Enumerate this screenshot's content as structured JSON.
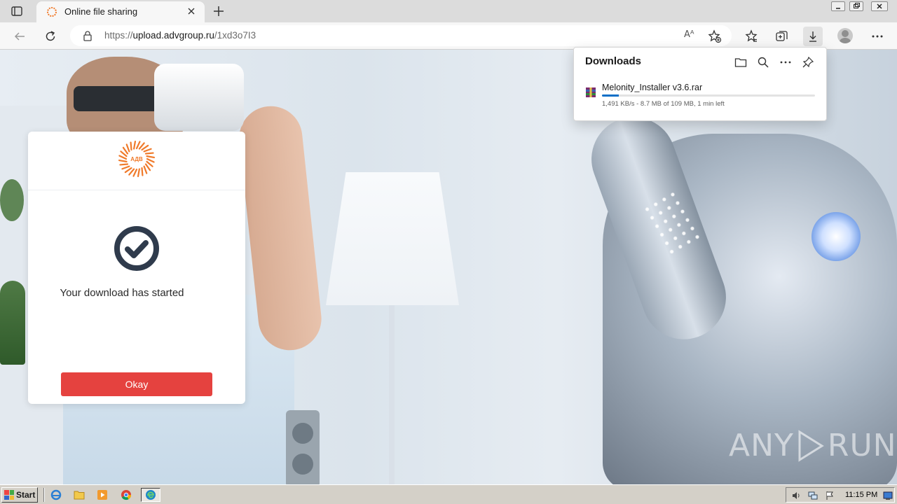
{
  "browser": {
    "tab": {
      "title": "Online file sharing",
      "favicon": "adv-sun-icon"
    },
    "address": {
      "url_scheme": "https://",
      "url_host": "upload.advgroup.ru",
      "url_path": "/1xd3o7I3",
      "read_aloud_label": "Aᴬ"
    },
    "icons": [
      "sidebar-icon",
      "close-icon",
      "plus-icon",
      "back-icon",
      "refresh-icon",
      "lock-icon",
      "read-aloud-icon",
      "add-favorite-icon",
      "favorites-icon",
      "collections-icon",
      "downloads-icon",
      "profile-icon",
      "more-icon"
    ]
  },
  "card": {
    "logo_text": "АДВ",
    "message": "Your download has started",
    "button_label": "Okay",
    "colors": {
      "button": "#e5423f",
      "check": "#2f3b4c",
      "logo": "#f07a2a"
    }
  },
  "downloads": {
    "title": "Downloads",
    "item": {
      "file_name": "Melonity_Installer v3.6.rar",
      "status": "1,491 KB/s - 8.7 MB of 109 MB, 1 min left",
      "progress_fraction": 0.08
    }
  },
  "watermark": {
    "left": "ANY",
    "right": "RUN"
  },
  "taskbar": {
    "start_label": "Start",
    "apps": [
      "ie-icon",
      "folder-icon",
      "media-player-icon",
      "chrome-icon",
      "edge-icon"
    ],
    "clock": "11:15 PM"
  }
}
